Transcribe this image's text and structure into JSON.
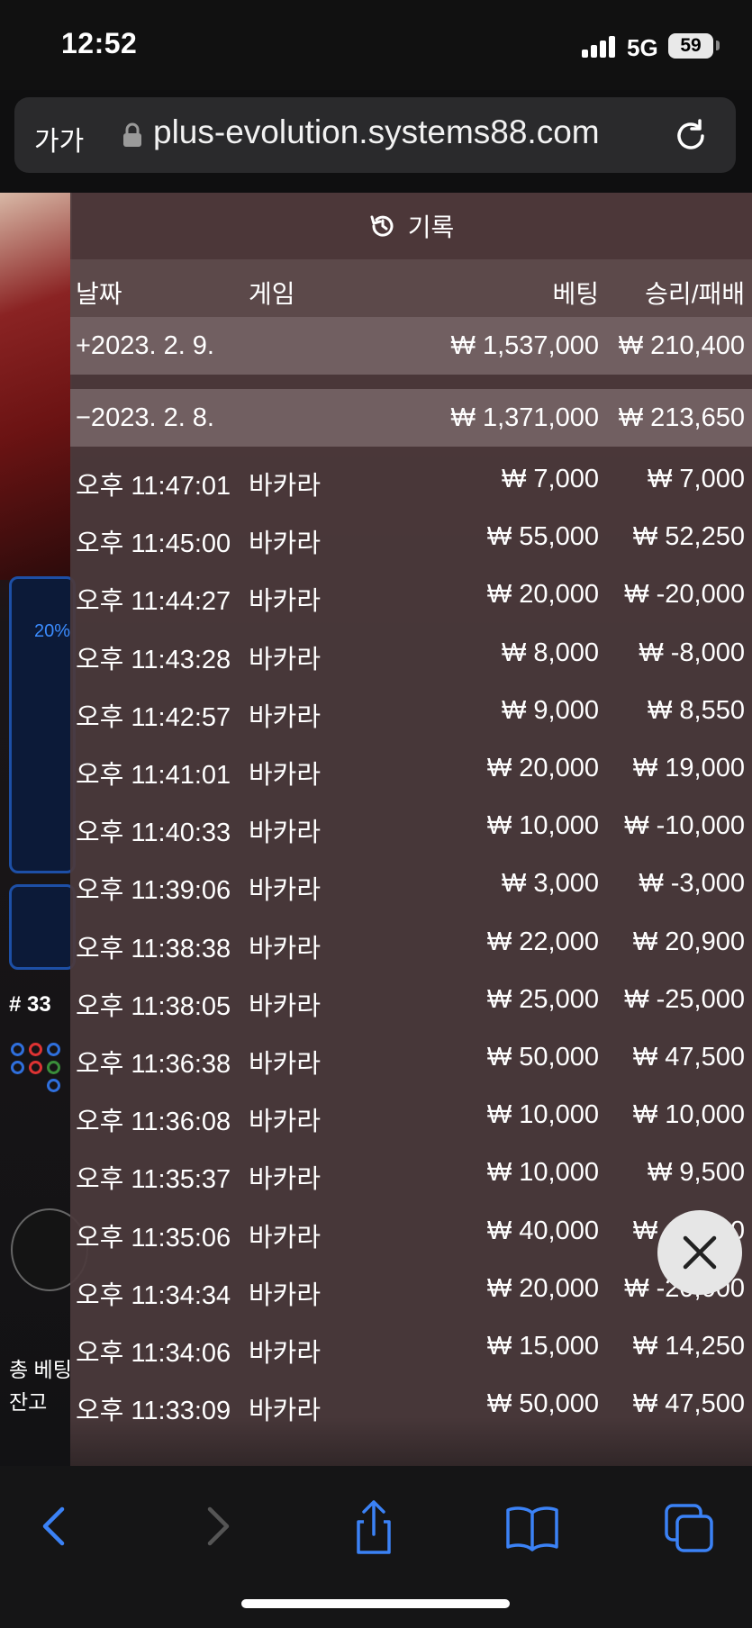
{
  "status_bar": {
    "time": "12:52",
    "network": "5G",
    "battery": "59"
  },
  "browser": {
    "text_size_label": "가가",
    "url": "plus-evolution.systems88.com"
  },
  "background": {
    "progress_percent": "20%",
    "round_label": "# 33",
    "total_bet_label": "총 베팅",
    "balance_label": "잔고"
  },
  "history": {
    "title": "기록",
    "columns": {
      "date": "날짜",
      "game": "게임",
      "bet": "베팅",
      "win_loss": "승리/패배"
    },
    "groups": [
      {
        "toggle_date": "+2023. 2. 9.",
        "bet": "₩ 1,537,000",
        "win_loss": "₩ 210,400"
      },
      {
        "toggle_date": "−2023. 2. 8.",
        "bet": "₩ 1,371,000",
        "win_loss": "₩ 213,650"
      }
    ],
    "rows": [
      {
        "time": "오후 11:47:01",
        "game": "바카라",
        "bet": "₩ 7,000",
        "win_loss": "₩ 7,000"
      },
      {
        "time": "오후 11:45:00",
        "game": "바카라",
        "bet": "₩ 55,000",
        "win_loss": "₩ 52,250"
      },
      {
        "time": "오후 11:44:27",
        "game": "바카라",
        "bet": "₩ 20,000",
        "win_loss": "₩ -20,000"
      },
      {
        "time": "오후 11:43:28",
        "game": "바카라",
        "bet": "₩ 8,000",
        "win_loss": "₩ -8,000"
      },
      {
        "time": "오후 11:42:57",
        "game": "바카라",
        "bet": "₩ 9,000",
        "win_loss": "₩ 8,550"
      },
      {
        "time": "오후 11:41:01",
        "game": "바카라",
        "bet": "₩ 20,000",
        "win_loss": "₩ 19,000"
      },
      {
        "time": "오후 11:40:33",
        "game": "바카라",
        "bet": "₩ 10,000",
        "win_loss": "₩ -10,000"
      },
      {
        "time": "오후 11:39:06",
        "game": "바카라",
        "bet": "₩ 3,000",
        "win_loss": "₩ -3,000"
      },
      {
        "time": "오후 11:38:38",
        "game": "바카라",
        "bet": "₩ 22,000",
        "win_loss": "₩ 20,900"
      },
      {
        "time": "오후 11:38:05",
        "game": "바카라",
        "bet": "₩ 25,000",
        "win_loss": "₩ -25,000"
      },
      {
        "time": "오후 11:36:38",
        "game": "바카라",
        "bet": "₩ 50,000",
        "win_loss": "₩ 47,500"
      },
      {
        "time": "오후 11:36:08",
        "game": "바카라",
        "bet": "₩ 10,000",
        "win_loss": "₩ 10,000"
      },
      {
        "time": "오후 11:35:37",
        "game": "바카라",
        "bet": "₩ 10,000",
        "win_loss": "₩ 9,500"
      },
      {
        "time": "오후 11:35:06",
        "game": "바카라",
        "bet": "₩ 40,000",
        "win_loss": "₩ 40,000"
      },
      {
        "time": "오후 11:34:34",
        "game": "바카라",
        "bet": "₩ 20,000",
        "win_loss": "₩ -20,000"
      },
      {
        "time": "오후 11:34:06",
        "game": "바카라",
        "bet": "₩ 15,000",
        "win_loss": "₩ 14,250"
      },
      {
        "time": "오후 11:33:09",
        "game": "바카라",
        "bet": "₩ 50,000",
        "win_loss": "₩ 47,500"
      }
    ]
  },
  "icons": {
    "history": "history-clock-icon",
    "close": "close-icon",
    "back": "chevron-left-icon",
    "forward": "chevron-right-icon",
    "share": "share-icon",
    "bookmarks": "book-icon",
    "tabs": "tabs-icon",
    "lock": "lock-icon",
    "reload": "reload-icon"
  },
  "colors": {
    "accent": "#3b82f6",
    "overlay": "#4b3a3c",
    "close_bg": "#e6e6e6"
  }
}
